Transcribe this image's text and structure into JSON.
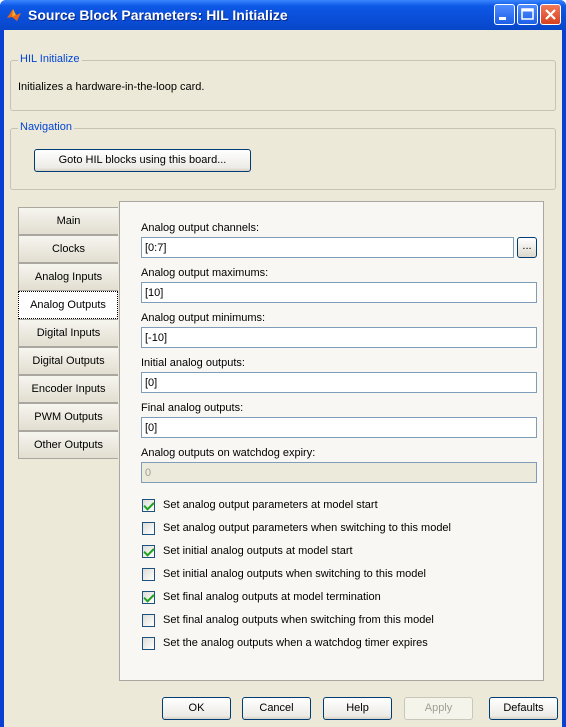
{
  "window": {
    "title": "Source Block Parameters: HIL Initialize"
  },
  "description_group": {
    "label": "HIL Initialize",
    "text": "Initializes a hardware-in-the-loop card."
  },
  "navigation_group": {
    "label": "Navigation",
    "goto_button": "Goto HIL blocks using this board..."
  },
  "tabs": [
    {
      "label": "Main",
      "active": false
    },
    {
      "label": "Clocks",
      "active": false
    },
    {
      "label": "Analog Inputs",
      "active": false
    },
    {
      "label": "Analog Outputs",
      "active": true
    },
    {
      "label": "Digital Inputs",
      "active": false
    },
    {
      "label": "Digital Outputs",
      "active": false
    },
    {
      "label": "Encoder Inputs",
      "active": false
    },
    {
      "label": "PWM Outputs",
      "active": false
    },
    {
      "label": "Other Outputs",
      "active": false
    }
  ],
  "fields": {
    "channels": {
      "label": "Analog output channels:",
      "value": "[0:7]",
      "browse": "..."
    },
    "maximums": {
      "label": "Analog output maximums:",
      "value": "[10]"
    },
    "minimums": {
      "label": "Analog output minimums:",
      "value": "[-10]"
    },
    "initial": {
      "label": "Initial analog outputs:",
      "value": "[0]"
    },
    "final": {
      "label": "Final analog outputs:",
      "value": "[0]"
    },
    "watchdog": {
      "label": "Analog outputs on watchdog expiry:",
      "value": "0"
    }
  },
  "checkboxes": [
    {
      "label": "Set analog output parameters at model start",
      "checked": true
    },
    {
      "label": "Set analog output parameters when switching to this model",
      "checked": false
    },
    {
      "label": "Set initial analog outputs at model start",
      "checked": true
    },
    {
      "label": "Set initial analog outputs when switching to this model",
      "checked": false
    },
    {
      "label": "Set final analog outputs at model termination",
      "checked": true
    },
    {
      "label": "Set final analog outputs when switching from this model",
      "checked": false
    },
    {
      "label": "Set the analog outputs when a watchdog timer expires",
      "checked": false
    }
  ],
  "buttons": {
    "ok": "OK",
    "cancel": "Cancel",
    "help": "Help",
    "apply": "Apply",
    "defaults": "Defaults"
  }
}
